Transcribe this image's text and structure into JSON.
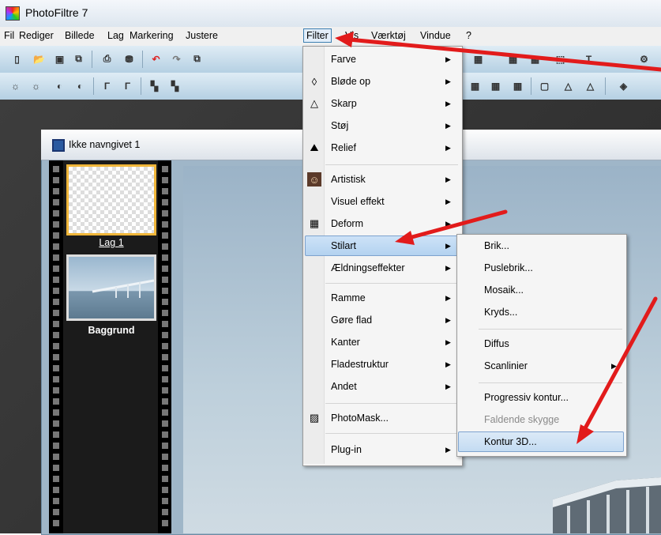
{
  "window": {
    "title": "PhotoFiltre 7"
  },
  "menubar": {
    "items": [
      "Fil",
      "Rediger",
      "Billede",
      "Lag",
      "Markering",
      "Justere",
      "Filter",
      "Vis",
      "Værktøj",
      "Vindue",
      "?"
    ]
  },
  "document": {
    "title": "Ikke navngivet 1",
    "layers": [
      {
        "label": "Lag 1"
      },
      {
        "label": "Baggrund"
      }
    ]
  },
  "filter_menu": {
    "items": [
      {
        "label": "Farve",
        "icon": "none",
        "submenu": true
      },
      {
        "label": "Bløde op",
        "icon": "drop-outline-icon",
        "submenu": true
      },
      {
        "label": "Skarp",
        "icon": "triangle-outline-icon",
        "submenu": true
      },
      {
        "label": "Støj",
        "icon": "none",
        "submenu": true
      },
      {
        "label": "Relief",
        "icon": "relief-icon",
        "submenu": true
      },
      {
        "label": "Artistisk",
        "icon": "portrait-icon",
        "submenu": true
      },
      {
        "label": "Visuel effekt",
        "icon": "none",
        "submenu": true
      },
      {
        "label": "Deform",
        "icon": "grid-icon",
        "submenu": true
      },
      {
        "label": "Stilart",
        "icon": "none",
        "submenu": true,
        "highlighted": true
      },
      {
        "label": "Ældningseffekter",
        "icon": "none",
        "submenu": true
      },
      {
        "label": "Ramme",
        "icon": "none",
        "submenu": true
      },
      {
        "label": "Gøre flad",
        "icon": "none",
        "submenu": true
      },
      {
        "label": "Kanter",
        "icon": "none",
        "submenu": true
      },
      {
        "label": "Fladestruktur",
        "icon": "none",
        "submenu": true
      },
      {
        "label": "Andet",
        "icon": "none",
        "submenu": true
      },
      {
        "label": "PhotoMask...",
        "icon": "mask-icon",
        "submenu": false
      },
      {
        "label": "Plug-in",
        "icon": "none",
        "submenu": true
      }
    ]
  },
  "stilart_submenu": {
    "items": [
      {
        "label": "Brik..."
      },
      {
        "label": "Puslebrik..."
      },
      {
        "label": "Mosaik..."
      },
      {
        "label": "Kryds..."
      },
      {
        "label": "Diffus"
      },
      {
        "label": "Scanlinier",
        "submenu": true
      },
      {
        "label": "Progressiv kontur..."
      },
      {
        "label": "Faldende skygge",
        "disabled": true
      },
      {
        "label": "Kontur 3D...",
        "highlighted": true
      }
    ]
  },
  "colors": {
    "annotation_arrow": "#e21b1b",
    "highlight": "#b3d2f0",
    "layer_selected_border": "#f0b63a"
  }
}
